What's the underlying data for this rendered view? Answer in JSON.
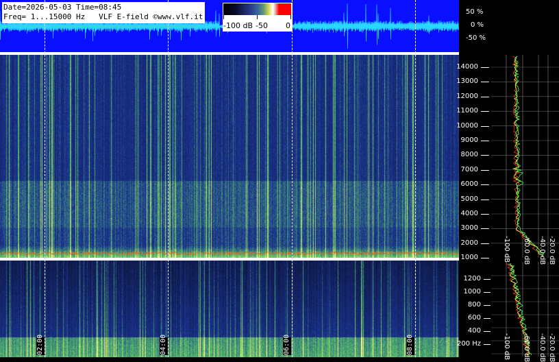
{
  "header": {
    "line1": "Date=2026-05-03 Time=08:45",
    "line2": "Freq= 1...15000 Hz   VLF E-field ©www.vlf.it"
  },
  "color_scale": {
    "min_label": "-100 dB",
    "mid_label": "-50",
    "max_label": "0"
  },
  "waveform_scale": [
    "50 %",
    "0 %",
    "-50 %"
  ],
  "time_labels": [
    "02:00",
    "04:00",
    "06:00",
    "08:00"
  ],
  "freq_axis_main": [
    "14000",
    "13000",
    "12000",
    "11000",
    "10000",
    "9000",
    "8000",
    "7000",
    "6000",
    "5000",
    "4000",
    "3000",
    "2000",
    "1000"
  ],
  "freq_axis_low": [
    "1200",
    "1000",
    "800",
    "600",
    "400",
    "200 Hz"
  ],
  "psd_axis": [
    "-100 dB",
    "-60.0 dB",
    "-40.0 dB",
    "-20.0 dB"
  ],
  "colors": {
    "waveform_bg": "#0a10ff",
    "waveform_trace": "#2ad8ff",
    "psd_line_a": "#ff3a1a",
    "psd_line_b": "#e8ff40",
    "psd_line_c": "#40ff60"
  }
}
